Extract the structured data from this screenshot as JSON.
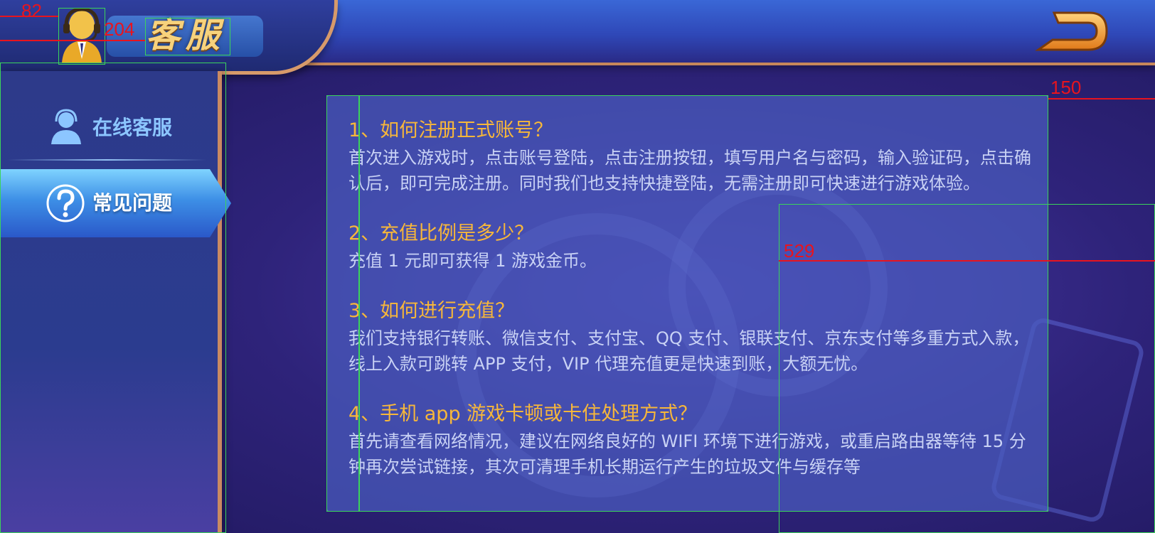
{
  "header": {
    "title": "客服",
    "avatar_icon": "customer-service-agent-icon",
    "back_icon": "return-arrow-icon"
  },
  "annotations": {
    "a82": "82",
    "a204": "204",
    "a150": "150",
    "a529": "529"
  },
  "sidebar": {
    "items": [
      {
        "label": "在线客服",
        "icon": "headset-person-icon",
        "active": false
      },
      {
        "label": "常见问题",
        "icon": "question-mark-icon",
        "active": true
      }
    ]
  },
  "faq": {
    "items": [
      {
        "question": "1、如何注册正式账号？",
        "answer": "首次进入游戏时，点击账号登陆，点击注册按钮，填写用户名与密码，输入验证码，点击确认后，即可完成注册。同时我们也支持快捷登陆，无需注册即可快速进行游戏体验。"
      },
      {
        "question": "2、充值比例是多少？",
        "answer": "充值 1 元即可获得 1 游戏金币。"
      },
      {
        "question": "3、如何进行充值？",
        "answer": "我们支持银行转账、微信支付、支付宝、QQ 支付、银联支付、京东支付等多重方式入款，线上入款可跳转 APP 支付，VIP 代理充值更是快速到账，大额无忧。"
      },
      {
        "question": "4、手机 app 游戏卡顿或卡住处理方式？",
        "answer": "首先请查看网络情况，建议在网络良好的 WIFI 环境下进行游戏，或重启路由器等待 15 分钟再次尝试链接，其次可清理手机长期运行产生的垃圾文件与缓存等"
      }
    ]
  },
  "colors": {
    "question": "#f7b73a",
    "answer": "#c9d2f5",
    "annotation": "#e8141e",
    "guide": "#3bd45a"
  }
}
